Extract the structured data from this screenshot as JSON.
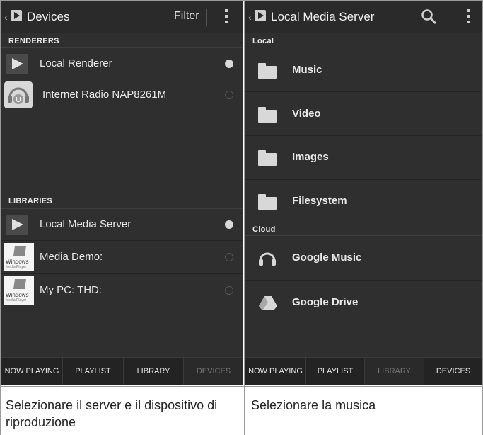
{
  "left": {
    "title": "Devices",
    "filter_label": "Filter",
    "renderers_header": "RENDERERS",
    "renderers": [
      {
        "label": "Local Renderer",
        "selected": true
      },
      {
        "label": "Internet Radio NAP8261M",
        "selected": false
      }
    ],
    "libraries_header": "LIBRARIES",
    "libraries": [
      {
        "label": "Local Media Server",
        "selected": true
      },
      {
        "label": "Media Demo:",
        "selected": false
      },
      {
        "label": "My PC:  THD:",
        "selected": false
      }
    ],
    "windows_icon_text": "Windows",
    "windows_icon_subtext": "Media Player",
    "tabs": [
      "NOW PLAYING",
      "PLAYLIST",
      "LIBRARY",
      "DEVICES"
    ],
    "active_tab": "DEVICES"
  },
  "right": {
    "title": "Local Media Server",
    "local_header": "Local",
    "local_items": [
      "Music",
      "Video",
      "Images",
      "Filesystem"
    ],
    "cloud_header": "Cloud",
    "cloud_items": [
      "Google Music",
      "Google Drive"
    ],
    "tabs": [
      "NOW PLAYING",
      "PLAYLIST",
      "LIBRARY",
      "DEVICES"
    ],
    "active_tab": "LIBRARY"
  },
  "captions": {
    "left": "Selezionare il server e il dispositivo di riproduzione",
    "right": "Selezionare la musica"
  },
  "icons": [
    "back-icon",
    "app-logo-icon",
    "overflow-menu-icon",
    "search-icon",
    "play-icon",
    "radio-u-icon",
    "windows-media-player-icon",
    "folder-icon",
    "headphones-icon",
    "google-drive-icon"
  ]
}
